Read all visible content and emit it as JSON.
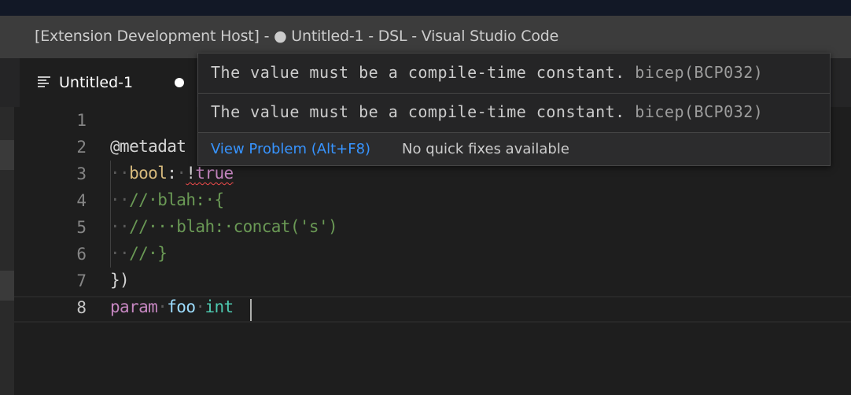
{
  "window": {
    "title": "[Extension Development Host] - ● Untitled-1 - DSL - Visual Studio Code"
  },
  "tab": {
    "label": "Untitled-1",
    "dirty": true,
    "icon": "lines-icon"
  },
  "editor": {
    "line_numbers": [
      "1",
      "2",
      "3",
      "4",
      "5",
      "6",
      "7",
      "8"
    ],
    "active_line": "8",
    "lines": {
      "l2": {
        "text": "@metadat"
      },
      "l3": {
        "indent": "··",
        "prop": "bool",
        "colon": ":",
        "space": "·",
        "op": "!",
        "value": "true"
      },
      "l4": {
        "indent": "··",
        "comment": "//·blah:·{"
      },
      "l5": {
        "indent": "··",
        "comment": "//···blah:·concat('s')"
      },
      "l6": {
        "indent": "··",
        "comment": "//·}"
      },
      "l7": {
        "text": "})"
      },
      "l8": {
        "kw": "param",
        "sp1": "·",
        "ident": "foo",
        "sp2": "·",
        "type": "int"
      }
    }
  },
  "hover": {
    "messages": [
      {
        "text": "The value must be a compile-time constant.",
        "source": "bicep(BCP032)"
      },
      {
        "text": "The value must be a compile-time constant.",
        "source": "bicep(BCP032)"
      }
    ],
    "view_problem": "View Problem (Alt+F8)",
    "no_quick_fixes": "No quick fixes available"
  },
  "colors": {
    "error_squiggle": "#f14c4c",
    "link": "#3794ff",
    "keyword": "#c586c0",
    "comment": "#6a9955",
    "type": "#4ec9b0"
  }
}
